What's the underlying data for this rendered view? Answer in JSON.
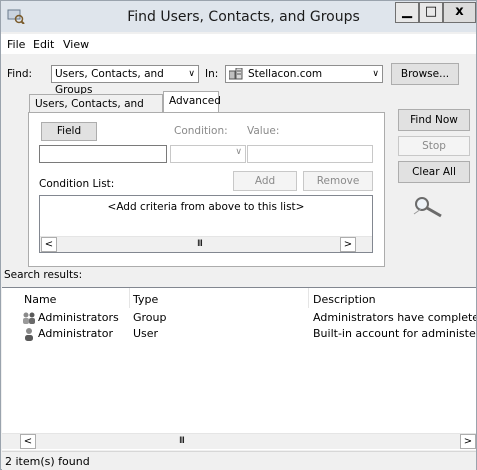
{
  "window": {
    "title": "Find Users, Contacts, and Groups",
    "minimize": "▁",
    "maximize": "□",
    "close": "x"
  },
  "menu": [
    "File",
    "Edit",
    "View"
  ],
  "find": {
    "label": "Find:",
    "value": "Users, Contacts, and Groups",
    "in_label": "In:",
    "in_value": "Stellacon.com",
    "browse": "Browse..."
  },
  "tabs": [
    {
      "label": "Users, Contacts, and Groups"
    },
    {
      "label": "Advanced"
    }
  ],
  "advanced": {
    "field_button": "Field",
    "condition_label": "Condition:",
    "value_label": "Value:",
    "condition_list_label": "Condition List:",
    "add": "Add",
    "remove": "Remove",
    "list_placeholder": "<Add criteria from above to this list>"
  },
  "actions": {
    "find_now": "Find Now",
    "stop": "Stop",
    "clear_all": "Clear All"
  },
  "results": {
    "label": "Search results:",
    "columns": [
      "Name",
      "Type",
      "Description"
    ],
    "rows": [
      {
        "name": "Administrators",
        "type": "Group",
        "description": "Administrators have complete and",
        "icon": "group-icon"
      },
      {
        "name": "Administrator",
        "type": "User",
        "description": "Built-in account for administering t",
        "icon": "user-icon"
      }
    ]
  },
  "status": "2 item(s) found",
  "colors": {
    "titlebar": "#dfe5ec",
    "window": "#f0f0f0",
    "border": "#828790"
  }
}
